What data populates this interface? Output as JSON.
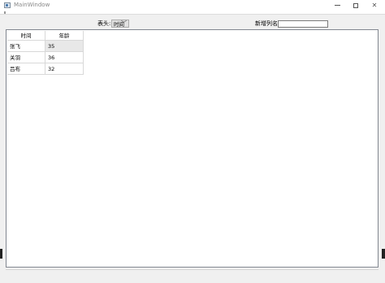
{
  "window": {
    "title": "MainWindow",
    "minimize_glyph": "",
    "close_glyph": "✕"
  },
  "toolbar": {
    "header_label": "表头:",
    "header_combo_value": "时间",
    "new_column_label": "新增列名:",
    "new_column_value": ""
  },
  "table": {
    "headers": [
      "时间",
      "年龄"
    ],
    "rows": [
      [
        "张飞",
        "35"
      ],
      [
        "关羽",
        "36"
      ],
      [
        "吕布",
        "32"
      ]
    ]
  },
  "icons": {
    "app": "app-window-icon",
    "combo_chevron": "chevron-down-icon"
  }
}
